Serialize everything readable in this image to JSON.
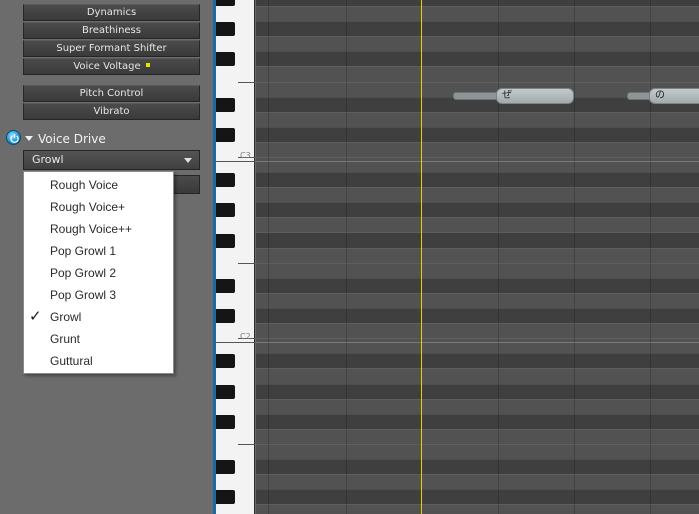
{
  "parameters": {
    "dynamics": "Dynamics",
    "breathiness": "Breathiness",
    "formant_shifter": "Super Formant Shifter",
    "voice_voltage": "Voice Voltage",
    "pitch_control": "Pitch Control",
    "vibrato": "Vibrato"
  },
  "voice_drive": {
    "title": "Voice Drive",
    "selected": "Growl",
    "options": [
      "Rough Voice",
      "Rough Voice+",
      "Rough Voice++",
      "Pop Growl 1",
      "Pop Growl 2",
      "Pop Growl 3",
      "Growl",
      "Grunt",
      "Guttural"
    ],
    "checked_index": 6
  },
  "piano": {
    "octave_labels": [
      "C3",
      "C2",
      "C1"
    ]
  },
  "notes": [
    {
      "lyric": "ぜ"
    },
    {
      "lyric": "の"
    }
  ],
  "colors": {
    "playhead": "#e3d200",
    "power_accent": "#1c8fce",
    "voltage_indicator": "#f0e000"
  }
}
